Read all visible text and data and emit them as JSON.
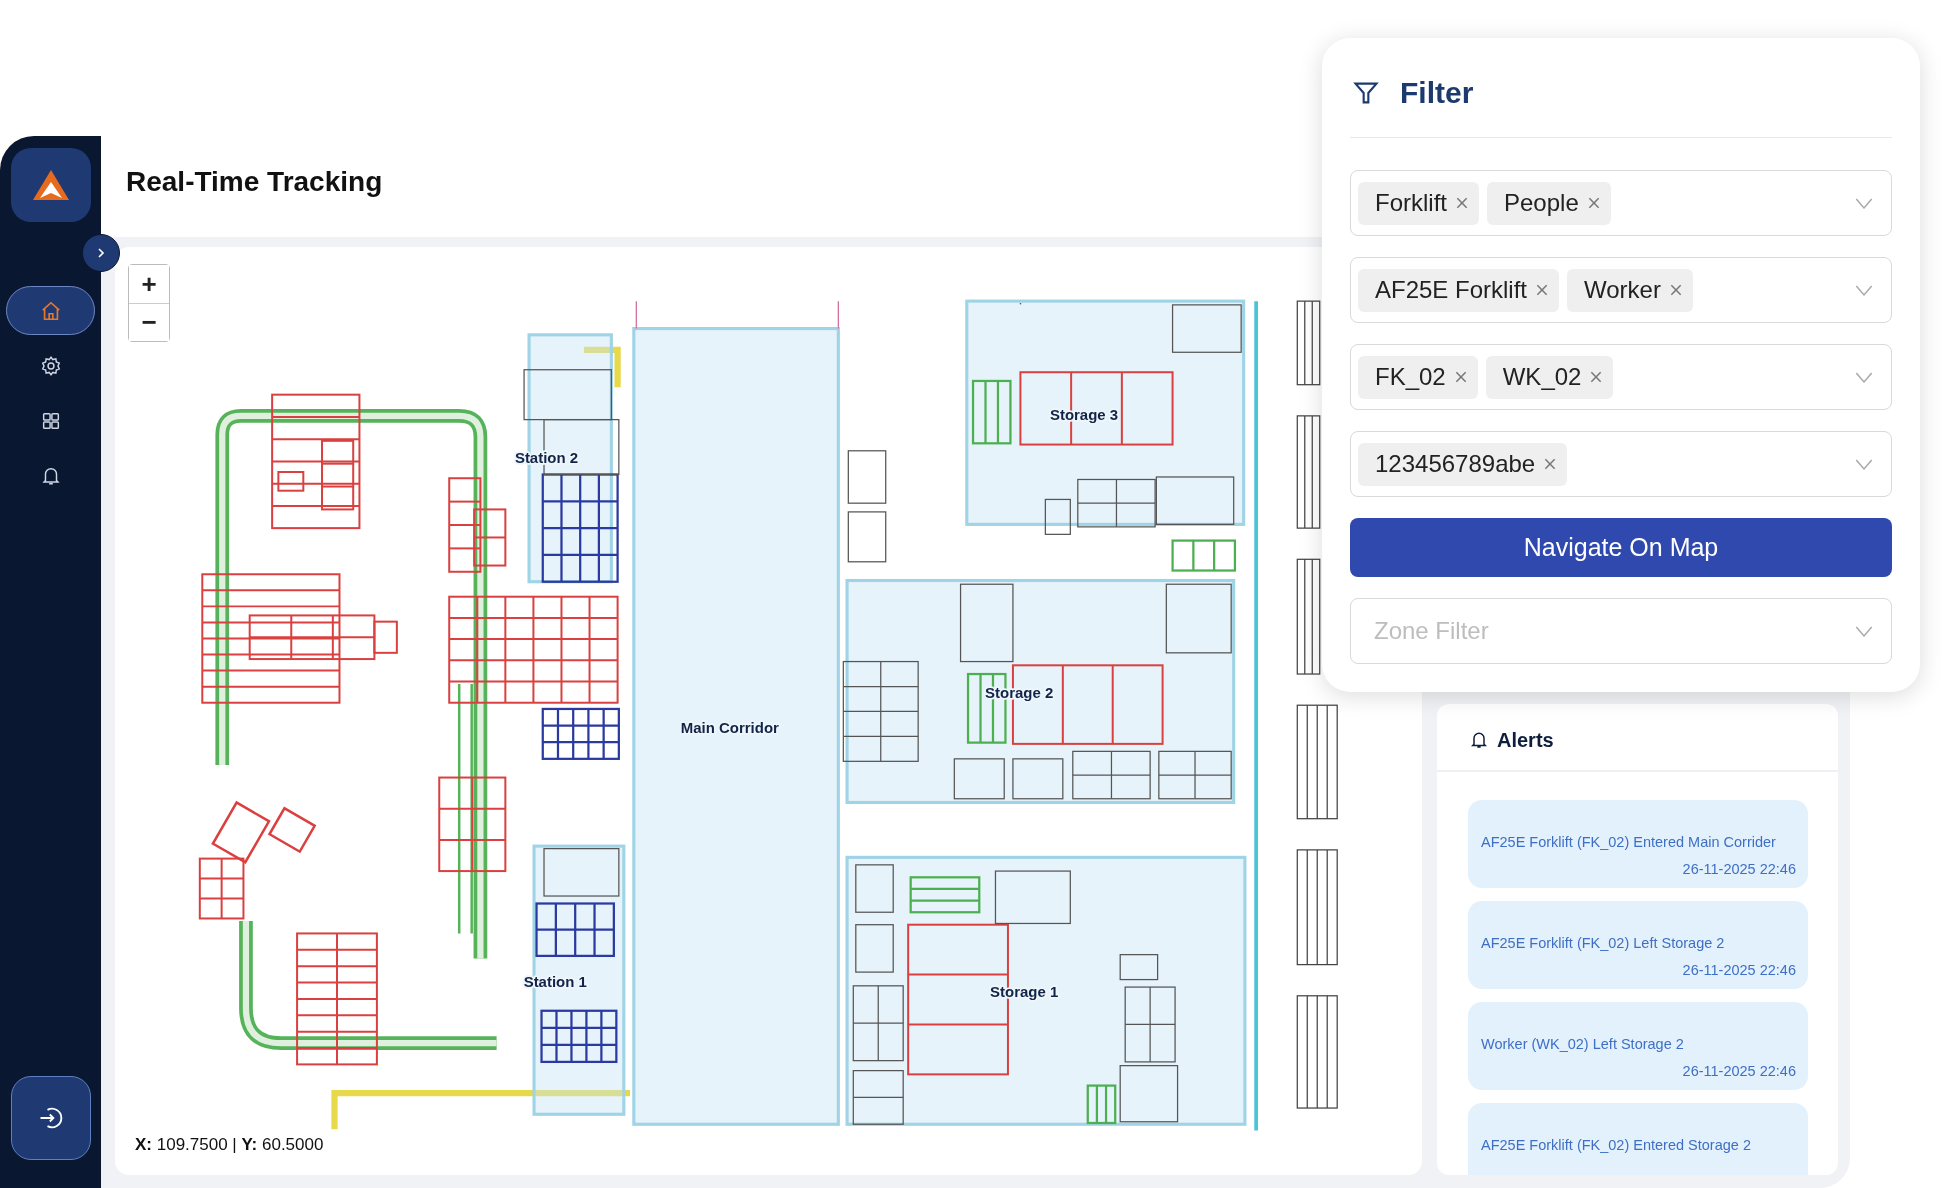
{
  "sidebar": {
    "items": [
      {
        "kind": "home",
        "selected": true
      },
      {
        "kind": "settings",
        "selected": false
      },
      {
        "kind": "grid",
        "selected": false
      },
      {
        "kind": "bell",
        "selected": false
      }
    ]
  },
  "title": "Real-Time Tracking",
  "map": {
    "zoom_in": "+",
    "zoom_out": "−",
    "zones": [
      {
        "label": "Station 2"
      },
      {
        "label": "Station 1"
      },
      {
        "label": "Main Corridor"
      },
      {
        "label": "Storage 3"
      },
      {
        "label": "Storage 2"
      },
      {
        "label": "Storage 1"
      }
    ],
    "coordinates": "**X:** 109.7500 | **Y:** 60.5000"
  },
  "filter": {
    "title": "Filter",
    "selects": [
      {
        "tags": [
          "Forklift",
          "People"
        ]
      },
      {
        "tags": [
          "AF25E Forklift",
          "Worker"
        ]
      },
      {
        "tags": [
          "FK_02",
          "WK_02"
        ]
      },
      {
        "tags": [
          "123456789abe"
        ]
      }
    ],
    "button": "Navigate On Map",
    "zone_filter": {
      "placeholder": "Zone Filter"
    }
  },
  "alerts": {
    "title": "Alerts",
    "items": [
      {
        "message": "AF25E Forklift (FK_02) Entered Main Corrider",
        "time": "26-11-2025 22:46"
      },
      {
        "message": "AF25E Forklift (FK_02) Left Storage 2",
        "time": "26-11-2025 22:46"
      },
      {
        "message": "Worker (WK_02) Left Storage 2",
        "time": "26-11-2025 22:46"
      },
      {
        "message": "AF25E Forklift (FK_02) Entered Storage 2"
      }
    ]
  }
}
